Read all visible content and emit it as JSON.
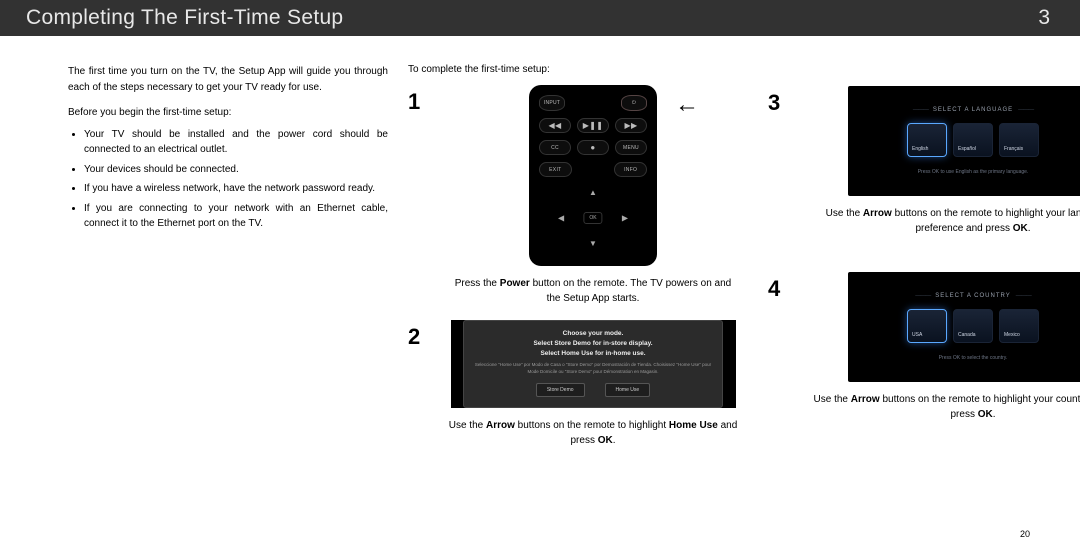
{
  "header": {
    "title": "Completing The First-Time Setup",
    "chapter": "3"
  },
  "page_number": "20",
  "intro": {
    "lead": "The first time you turn on the TV, the Setup App will guide you through each of the steps necessary to get your TV ready for use.",
    "pre": "Before you begin the first-time setup:",
    "bullets": [
      "Your TV should be installed and the power cord should be connected to an electrical outlet.",
      "Your devices should be connected.",
      "If you have a wireless network, have the network password ready.",
      "If you are connecting to your network with an Ethernet cable, connect it to the Ethernet port on the TV."
    ],
    "complete_lead": "To complete the first-time setup:"
  },
  "steps": {
    "s1": {
      "num": "1",
      "caption_a": "Press the ",
      "caption_b1": "Power",
      "caption_c": " button on the remote. The TV powers on and the Setup App starts."
    },
    "s2": {
      "num": "2",
      "caption_a": "Use the ",
      "caption_b1": "Arrow",
      "caption_c": " buttons on the remote to highlight ",
      "caption_b2": "Home Use",
      "caption_d": " and press ",
      "caption_b3": "OK",
      "caption_e": "."
    },
    "s3": {
      "num": "3",
      "caption_a": "Use the ",
      "caption_b1": "Arrow",
      "caption_c": " buttons on the remote to highlight your language of preference and press ",
      "caption_b2": "OK",
      "caption_d": "."
    },
    "s4": {
      "num": "4",
      "caption_a": "Use the ",
      "caption_b1": "Arrow",
      "caption_c": " buttons on the remote to highlight your country, and then press ",
      "caption_b2": "OK",
      "caption_d": "."
    }
  },
  "remote": {
    "input": "INPUT",
    "power": "⏻",
    "rw": "◀◀",
    "pp": "▶❚❚",
    "ff": "▶▶",
    "cc": "CC",
    "rec": "●",
    "menu": "MENU",
    "exit": "EXIT",
    "info": "INFO",
    "ok": "OK"
  },
  "mode_dialog": {
    "line1": "Choose your mode.",
    "line2": "Select Store Demo for in-store display.",
    "line3": "Select Home Use for in-home use.",
    "sub": "Seleccione \"Home Use\" por Modo de Casa o \"Store Demo\" por Demostración de Tienda. Choisissez \"Home Use\" pour Mode Domicile ou \"Store Demo\" pour Démonstration en Magasin.",
    "btn1": "Store Demo",
    "btn2": "Home Use"
  },
  "lang_screen": {
    "title": "SELECT A LANGUAGE",
    "opts": [
      "English",
      "Español",
      "Français"
    ],
    "selected": 0,
    "hint": "Press OK to use English as the primary language."
  },
  "country_screen": {
    "title": "SELECT A COUNTRY",
    "opts": [
      "USA",
      "Canada",
      "Mexico"
    ],
    "selected": 0,
    "hint": "Press OK to select the country."
  }
}
